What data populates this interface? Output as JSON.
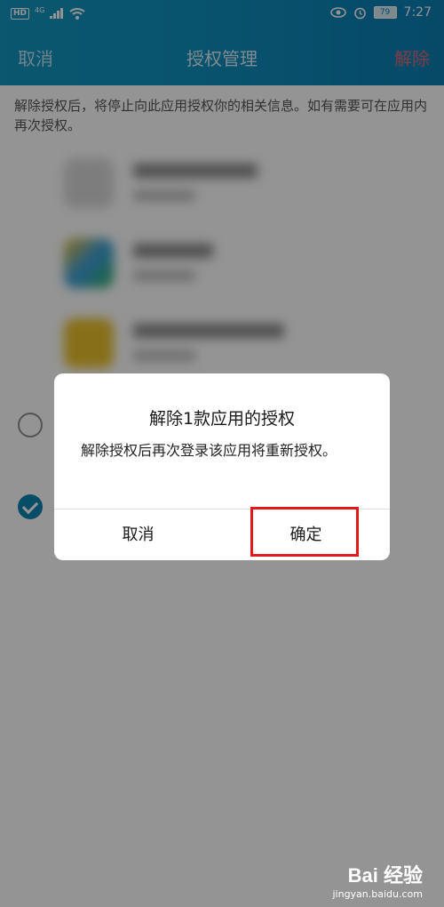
{
  "status_bar": {
    "network_badge": "HD",
    "network_type": "4G",
    "battery": "79",
    "time": "7:27"
  },
  "header": {
    "left_label": "取消",
    "title": "授权管理",
    "right_label": "解除"
  },
  "info_text": "解除授权后，将停止向此应用授权你的相关信息。如有需要可在应用内再次授权。",
  "dialog": {
    "title": "解除1款应用的授权",
    "message": "解除授权后再次登录该应用将重新授权。",
    "cancel_label": "取消",
    "confirm_label": "确定"
  },
  "colors": {
    "header_bg": "#1396c0",
    "accent": "#0d86b3",
    "destructive": "#d76a7a",
    "highlight": "#e0191b"
  },
  "watermark": {
    "logo": "Bai 经验",
    "url": "jingyan.baidu.com"
  }
}
